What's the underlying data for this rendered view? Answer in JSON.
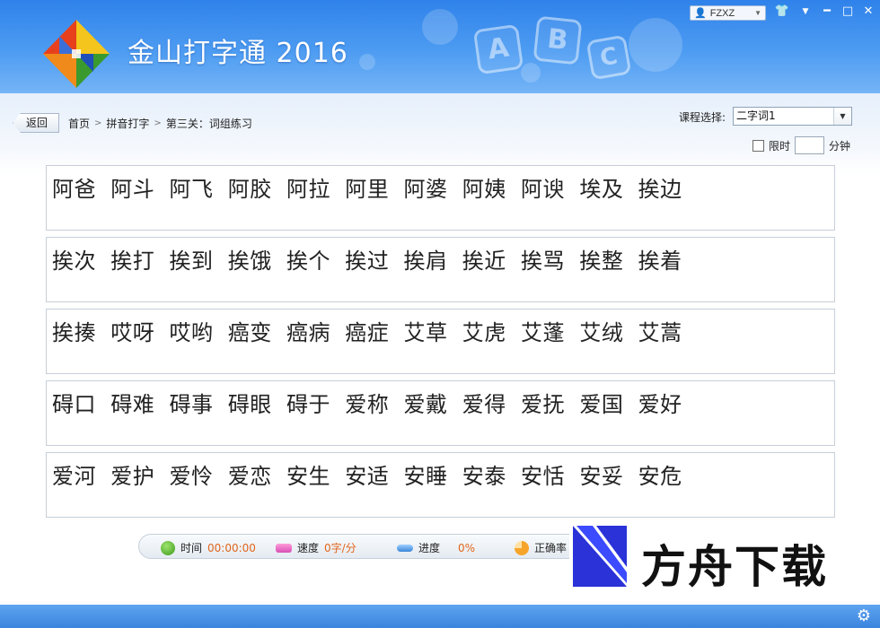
{
  "header": {
    "app_title": "金山打字通 2016",
    "user_name": "FZXZ",
    "letters": [
      "A",
      "B",
      "C"
    ]
  },
  "window_buttons": {
    "skin": "👕",
    "menu": "▼",
    "minimize": "━",
    "maximize": "□",
    "close": "✕"
  },
  "nav": {
    "back_label": "返回",
    "breadcrumb": [
      "首页",
      "拼音打字",
      "第三关：词组练习"
    ]
  },
  "course": {
    "label": "课程选择:",
    "selected": "二字词1"
  },
  "time_limit": {
    "label": "限时",
    "value": "",
    "unit": "分钟",
    "checked": false
  },
  "practice_lines": [
    "阿爸  阿斗  阿飞  阿胶  阿拉  阿里  阿婆  阿姨  阿谀  埃及  挨边",
    "挨次  挨打  挨到  挨饿  挨个  挨过  挨肩  挨近  挨骂  挨整  挨着",
    "挨揍  哎呀  哎哟  癌变  癌病  癌症  艾草  艾虎  艾蓬  艾绒  艾蒿",
    "碍口  碍难  碍事  碍眼  碍于  爱称  爱戴  爱得  爱抚  爱国  爱好",
    "爱河  爱护  爱怜  爱恋  安生  安适  安睡  安泰  安恬  安妥  安危"
  ],
  "stats": {
    "time_label": "时间",
    "time_value": "00:00:00",
    "speed_label": "速度",
    "speed_value": "0字/分",
    "progress_label": "进度",
    "progress_value": "0%",
    "accuracy_label": "正确率"
  },
  "watermark": {
    "text": "方舟下载"
  },
  "colors": {
    "header_blue": "#2f82ea",
    "stat_value": "#e2651b"
  }
}
